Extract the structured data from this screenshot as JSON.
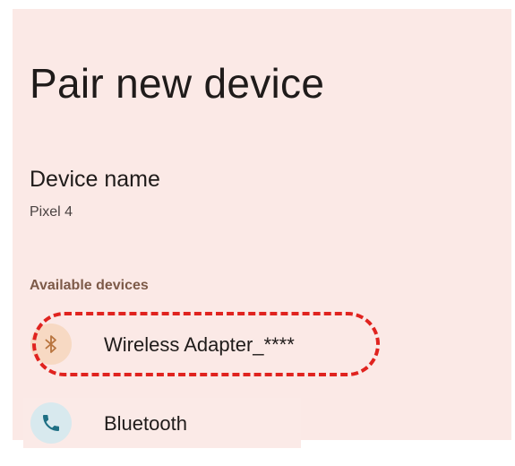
{
  "page": {
    "title": "Pair new device"
  },
  "device_name": {
    "label": "Device name",
    "value": "Pixel 4"
  },
  "available_devices": {
    "header": "Available devices",
    "items": [
      {
        "label": "Wireless Adapter_****",
        "icon": "bluetooth-icon",
        "icon_color": "#b8743e",
        "icon_bg": "#f7d9c3"
      },
      {
        "label": "Bluetooth",
        "icon": "phone-icon",
        "icon_color": "#1e6f84",
        "icon_bg": "#d8e9ee"
      }
    ]
  },
  "annotation": {
    "highlight_color": "#e0231f",
    "style": "dashed"
  },
  "colors": {
    "background": "#fbe9e6",
    "text": "#1f1b1a",
    "section_header": "#7d5a48"
  }
}
